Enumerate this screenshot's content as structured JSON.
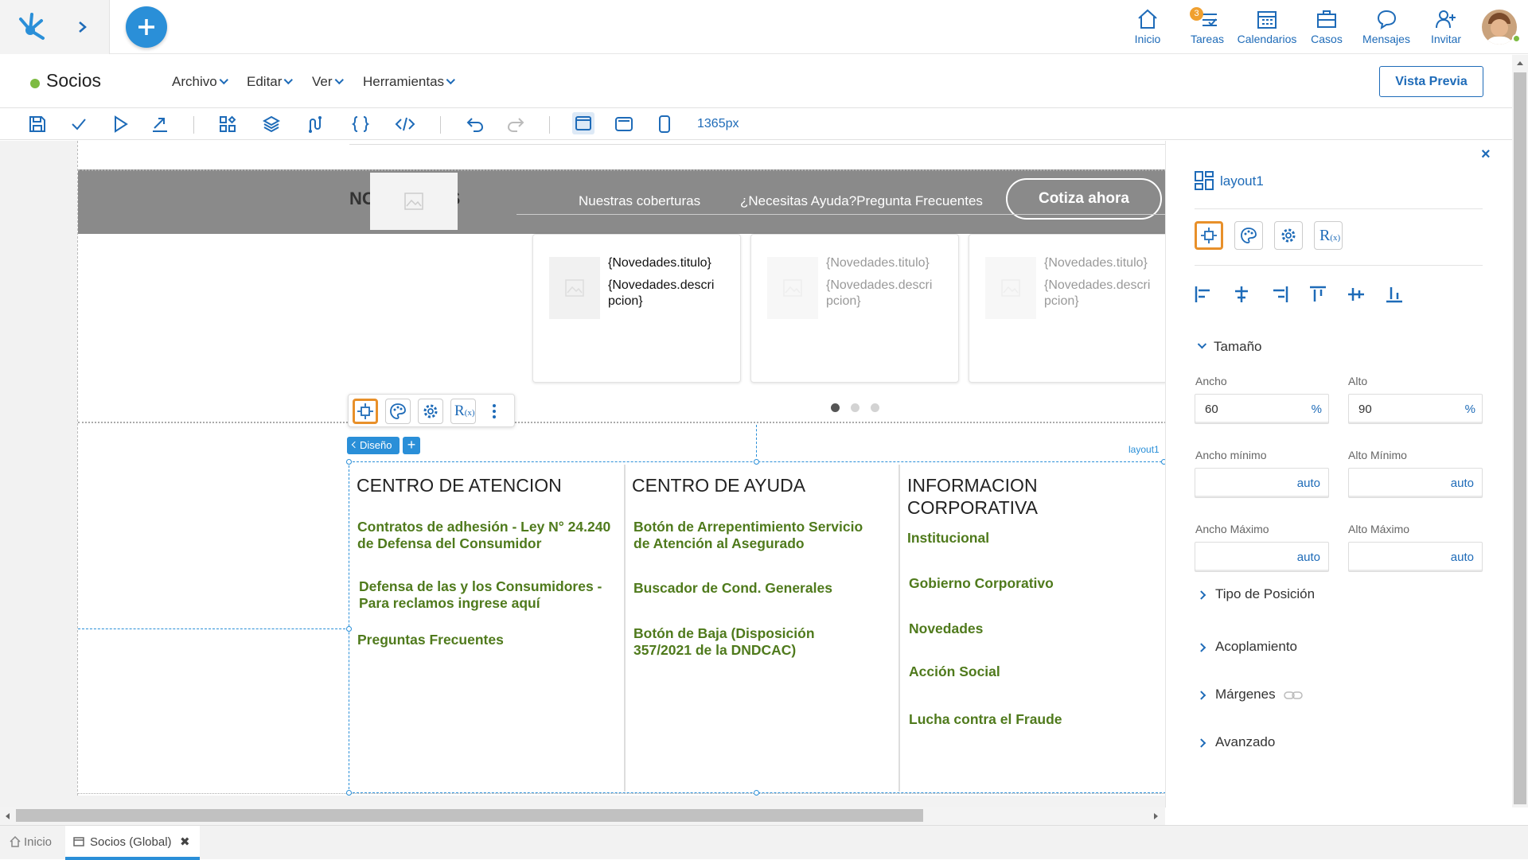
{
  "topnav": {
    "items": [
      {
        "label": "Inicio",
        "icon": "home-icon"
      },
      {
        "label": "Tareas",
        "icon": "tasks-icon",
        "badge": "3"
      },
      {
        "label": "Calendarios",
        "icon": "calendar-icon"
      },
      {
        "label": "Casos",
        "icon": "briefcase-icon"
      },
      {
        "label": "Mensajes",
        "icon": "chat-icon"
      },
      {
        "label": "Invitar",
        "icon": "add-user-icon"
      }
    ]
  },
  "app": {
    "title": "Socios",
    "status_color": "#7dbb42"
  },
  "menu": {
    "archivo": "Archivo",
    "editar": "Editar",
    "ver": "Ver",
    "herramientas": "Herramientas"
  },
  "preview_button": "Vista Previa",
  "toolbar": {
    "width_label": "1365px"
  },
  "canvas": {
    "header": {
      "logo_text": "NOVEDADES",
      "nav1": "Nuestras coberturas",
      "nav2": "¿Necesitas Ayuda?Pregunta Frecuentes",
      "cta": "Cotiza ahora"
    },
    "cards": [
      {
        "title": "{Novedades.titulo}",
        "desc": "{Novedades.descri pcion}"
      },
      {
        "title": "{Novedades.titulo}",
        "desc": "{Novedades.descri pcion}"
      },
      {
        "title": "{Novedades.titulo}",
        "desc": "{Novedades.descri pcion}"
      }
    ],
    "diseno_label": "Diseño",
    "layout_tag": "layout1",
    "columns": [
      {
        "title": "CENTRO DE ATENCION",
        "links": [
          "Contratos de adhesión - Ley N° 24.240 de Defensa del Consumidor",
          "Defensa de las y los Consumidores - Para reclamos ingrese aquí",
          "Preguntas Frecuentes"
        ]
      },
      {
        "title": "CENTRO DE AYUDA",
        "links": [
          "Botón de Arrepentimiento Servicio de Atención al Asegurado",
          "Buscador de Cond. Generales",
          "Botón de Baja (Disposición 357/2021 de la DNDCAC)"
        ]
      },
      {
        "title": "INFORMACION CORPORATIVA",
        "links": [
          "Institucional",
          "Gobierno Corporativo",
          "Novedades",
          "Acción Social",
          "Lucha contra el Fraude"
        ]
      }
    ]
  },
  "panel": {
    "title": "layout1",
    "close": "×",
    "tamano": "Tamaño",
    "ancho_label": "Ancho",
    "ancho_value": "60",
    "ancho_unit": "%",
    "alto_label": "Alto",
    "alto_value": "90",
    "alto_unit": "%",
    "ancho_min_label": "Ancho mínimo",
    "ancho_min_value": "auto",
    "alto_min_label": "Alto Mínimo",
    "alto_min_value": "auto",
    "ancho_max_label": "Ancho Máximo",
    "ancho_max_value": "auto",
    "alto_max_label": "Alto Máximo",
    "alto_max_value": "auto",
    "sections": [
      "Tipo de Posición",
      "Acoplamiento",
      "Márgenes",
      "Avanzado"
    ]
  },
  "bottom_tabs": [
    {
      "label": "Inicio"
    },
    {
      "label": "Socios (Global)",
      "close": "✖"
    }
  ],
  "colors": {
    "accent": "#1e6bb8",
    "link_green": "#4f7a1c",
    "selected_orange": "#e8902a",
    "header_gray": "#8a8a8a"
  }
}
